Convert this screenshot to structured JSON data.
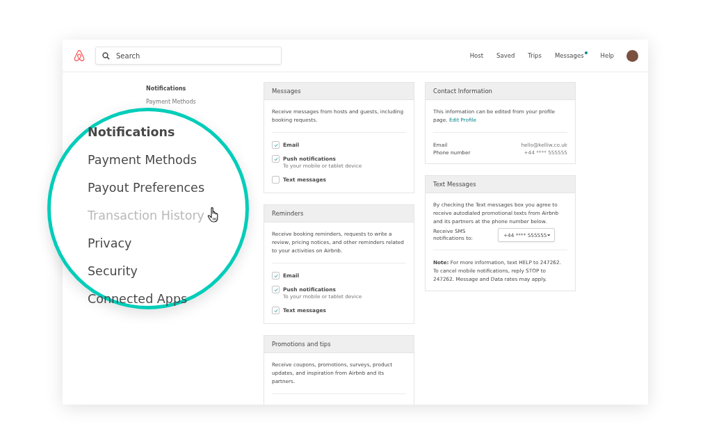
{
  "header": {
    "search": {
      "placeholder": "Search"
    },
    "nav": [
      {
        "label": "Host",
        "badge": false
      },
      {
        "label": "Saved",
        "badge": false
      },
      {
        "label": "Trips",
        "badge": false
      },
      {
        "label": "Messages",
        "badge": true
      },
      {
        "label": "Help",
        "badge": false
      }
    ]
  },
  "sidebar": {
    "items": [
      {
        "label": "Notifications",
        "selected": true
      },
      {
        "label": "Payment Methods",
        "selected": false
      }
    ]
  },
  "magnifier": {
    "items": [
      {
        "label": "Notifications",
        "selected": true,
        "hovered": false
      },
      {
        "label": "Payment Methods",
        "selected": false,
        "hovered": false
      },
      {
        "label": "Payout Preferences",
        "selected": false,
        "hovered": false
      },
      {
        "label": "Transaction History",
        "selected": false,
        "hovered": true
      },
      {
        "label": "Privacy",
        "selected": false,
        "hovered": false
      },
      {
        "label": "Security",
        "selected": false,
        "hovered": false
      },
      {
        "label": "Connected Apps",
        "selected": false,
        "hovered": false
      }
    ]
  },
  "notification_sections": [
    {
      "title": "Messages",
      "description": "Receive messages from hosts and guests, including booking requests.",
      "options": [
        {
          "label": "Email",
          "checked": true
        },
        {
          "label": "Push notifications",
          "sublabel": "To your mobile or tablet device",
          "checked": true
        },
        {
          "label": "Text messages",
          "checked": false
        }
      ]
    },
    {
      "title": "Reminders",
      "description": "Receive booking reminders, requests to write a review, pricing notices, and other reminders related to your activities on Airbnb.",
      "options": [
        {
          "label": "Email",
          "checked": true
        },
        {
          "label": "Push notifications",
          "sublabel": "To your mobile or tablet device",
          "checked": true
        },
        {
          "label": "Text messages",
          "checked": true
        }
      ]
    },
    {
      "title": "Promotions and tips",
      "description": "Receive coupons, promotions, surveys, product updates, and inspiration from Airbnb and its partners."
    }
  ],
  "contact": {
    "title": "Contact Information",
    "description": "This information can be edited from your profile page.",
    "link": "Edit Profile",
    "fields": [
      {
        "label": "Email",
        "value": "hello@kelliw.co.uk"
      },
      {
        "label": "Phone number",
        "value": "+44 **** 555555"
      }
    ]
  },
  "text_messages": {
    "title": "Text Messages",
    "description": "By checking the Text messages box you agree to receive autodialed promotional texts from Airbnb and its partners at the phone number below.",
    "sms_label": "Receive SMS notifications to:",
    "sms_value": "+44 **** 555555",
    "note": "**Note:** For more information, text HELP to 247262. To cancel mobile notifications, reply STOP to 247262. Message and Data rates may apply."
  }
}
